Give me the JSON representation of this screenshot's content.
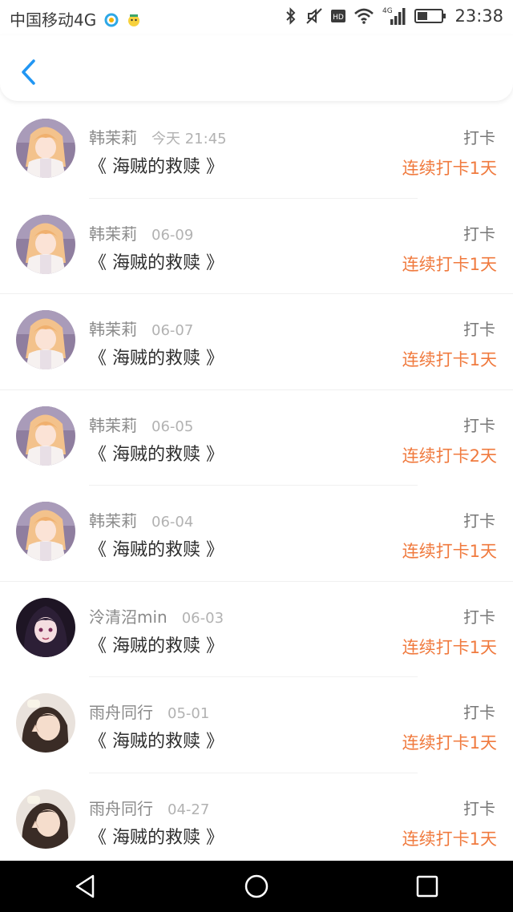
{
  "status_bar": {
    "carrier": "中国移动4G",
    "time": "23:38",
    "network": "4G",
    "hd_badge": "HD"
  },
  "header": {
    "back_icon": "chevron-left-icon",
    "accent_color": "#2196f3"
  },
  "colors": {
    "streak": "#f07a3e",
    "title": "#2d2d2d",
    "meta": "#8a8a8a"
  },
  "records": [
    {
      "user": "韩茉莉",
      "date": "今天 21:45",
      "title": "《 海贼的救赎 》",
      "action": "打卡",
      "streak": "连续打卡1天",
      "avatar": "avatar-anime-girl"
    },
    {
      "user": "韩茉莉",
      "date": "06-09",
      "title": "《 海贼的救赎 》",
      "action": "打卡",
      "streak": "连续打卡1天",
      "avatar": "avatar-anime-girl"
    },
    {
      "user": "韩茉莉",
      "date": "06-07",
      "title": "《 海贼的救赎 》",
      "action": "打卡",
      "streak": "连续打卡1天",
      "avatar": "avatar-anime-girl"
    },
    {
      "user": "韩茉莉",
      "date": "06-05",
      "title": "《 海贼的救赎 》",
      "action": "打卡",
      "streak": "连续打卡2天",
      "avatar": "avatar-anime-girl"
    },
    {
      "user": "韩茉莉",
      "date": "06-04",
      "title": "《 海贼的救赎 》",
      "action": "打卡",
      "streak": "连续打卡1天",
      "avatar": "avatar-anime-girl"
    },
    {
      "user": "泠清沼min",
      "date": "06-03",
      "title": "《 海贼的救赎 》",
      "action": "打卡",
      "streak": "连续打卡1天",
      "avatar": "avatar-dark-anime"
    },
    {
      "user": "雨舟同行",
      "date": "05-01",
      "title": "《 海贼的救赎 》",
      "action": "打卡",
      "streak": "连续打卡1天",
      "avatar": "avatar-photo-girl"
    },
    {
      "user": "雨舟同行",
      "date": "04-27",
      "title": "《 海贼的救赎 》",
      "action": "打卡",
      "streak": "连续打卡1天",
      "avatar": "avatar-photo-girl"
    }
  ]
}
